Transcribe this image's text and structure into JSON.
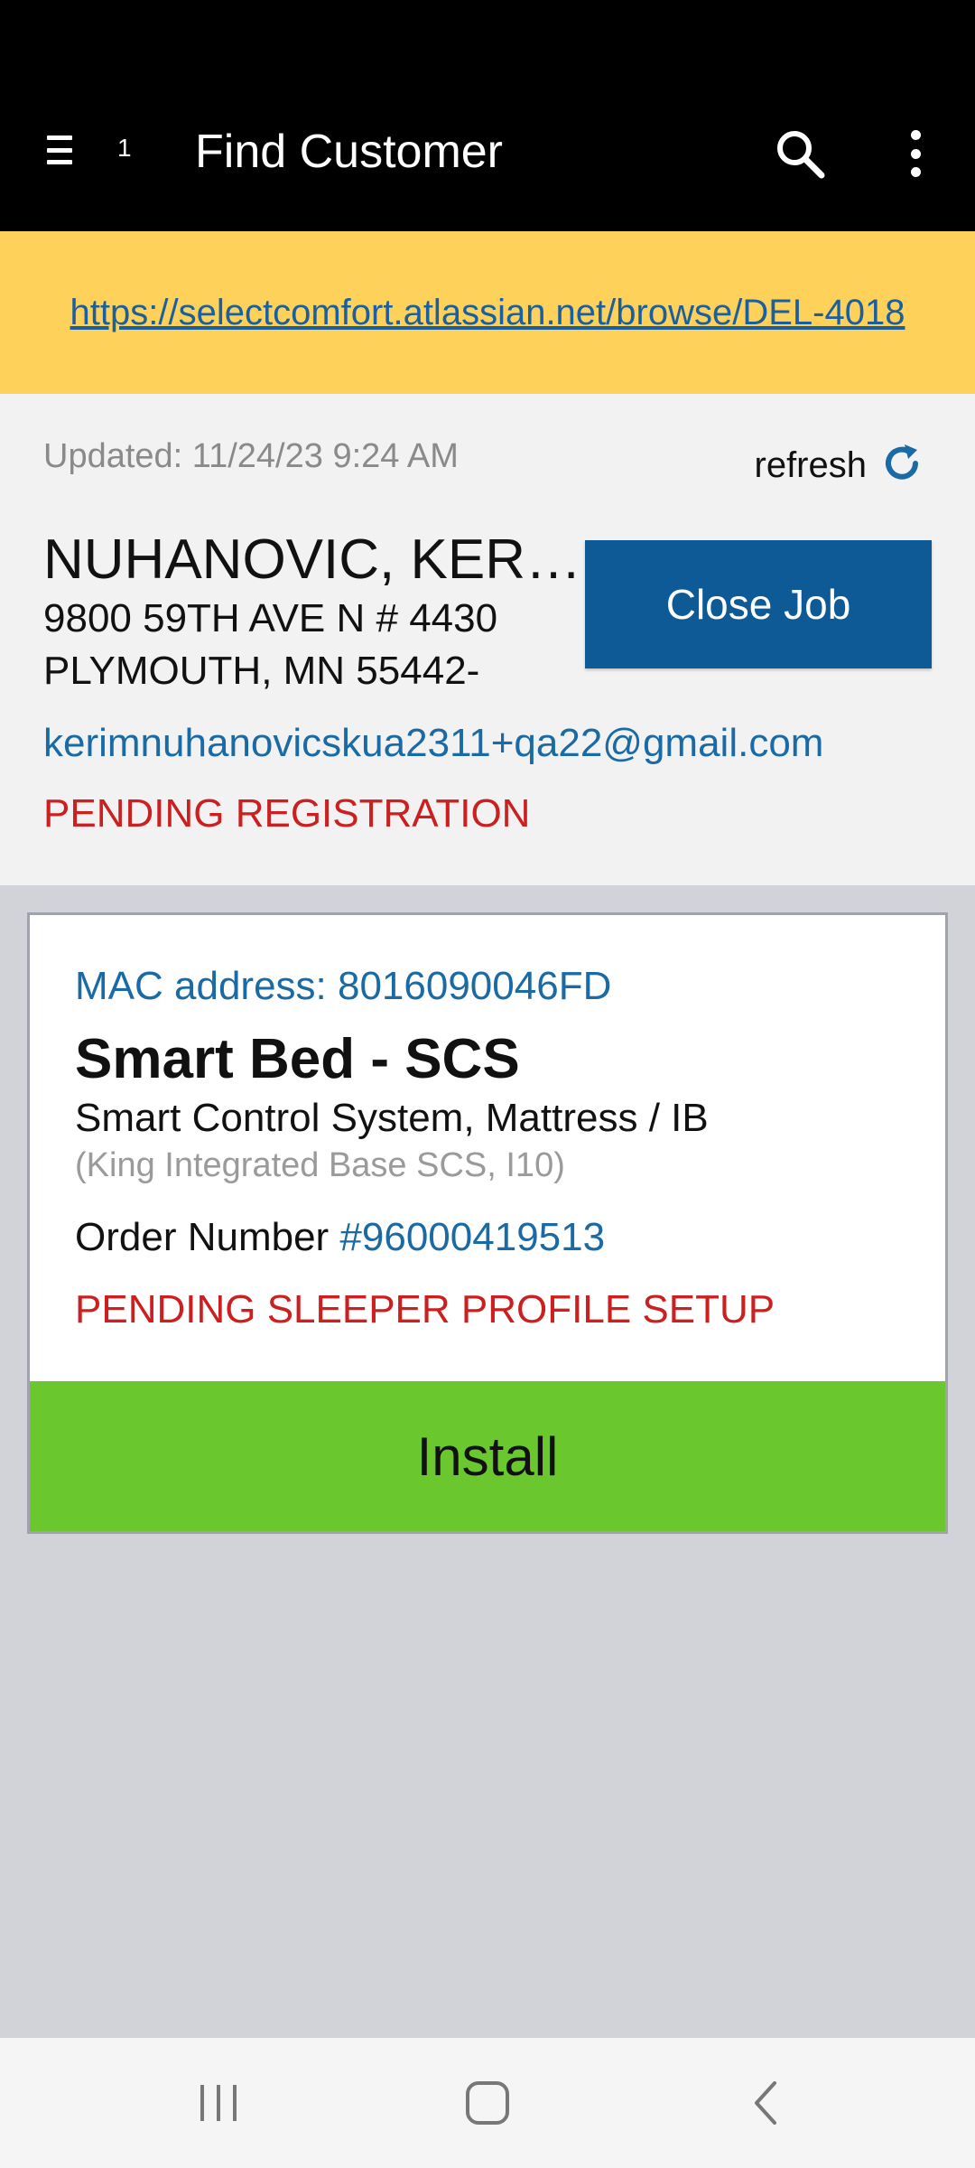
{
  "app_bar": {
    "badge_count": "1",
    "title": "Find Customer"
  },
  "banner": {
    "link": "https://selectcomfort.atlassian.net/browse/DEL-4018"
  },
  "customer": {
    "updated": "Updated: 11/24/23 9:24 AM",
    "refresh_label": "refresh",
    "name": "NUHANOVIC, KERIM",
    "address_line1": "9800 59TH AVE N # 4430",
    "address_line2": "PLYMOUTH, MN 55442-",
    "email": "kerimnuhanovicskua2311+qa22@gmail.com",
    "status": "PENDING REGISTRATION",
    "close_job_label": "Close Job"
  },
  "device": {
    "mac": "MAC address: 8016090046FD",
    "product": "Smart Bed - SCS",
    "description": "Smart Control System, Mattress / IB",
    "sub_description": "(King Integrated Base SCS, I10)",
    "order_label": "Order Number",
    "order_number": "#96000419513",
    "status": "PENDING SLEEPER PROFILE SETUP",
    "install_label": "Install"
  },
  "icons": {
    "menu": "hamburger-icon",
    "search": "search-icon",
    "more": "more-vert-icon",
    "refresh": "refresh-icon",
    "nav_recents": "recents-icon",
    "nav_home": "home-icon",
    "nav_back": "back-icon"
  },
  "colors": {
    "banner": "#fdd15a",
    "close_job": "#0d5a96",
    "install": "#6ac72e",
    "status_red": "#cc1f1f",
    "link_blue": "#1a6aa6"
  }
}
